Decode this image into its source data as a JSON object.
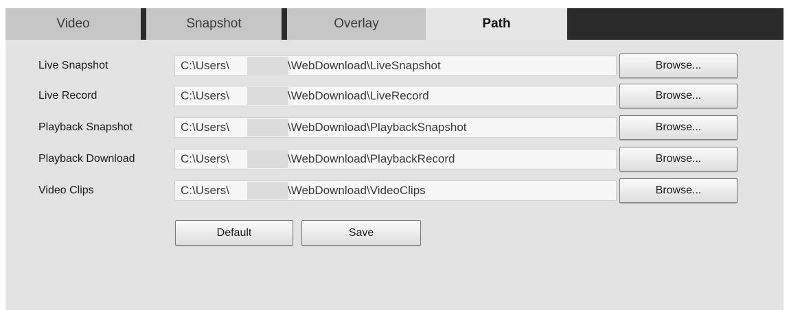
{
  "tabs": [
    {
      "label": "Video",
      "active": false
    },
    {
      "label": "Snapshot",
      "active": false
    },
    {
      "label": "Overlay",
      "active": false
    },
    {
      "label": "Path",
      "active": true
    }
  ],
  "paths": [
    {
      "label": "Live Snapshot",
      "prefix": "C:\\Users\\",
      "suffix": "\\WebDownload\\LiveSnapshot",
      "button": "Browse..."
    },
    {
      "label": "Live Record",
      "prefix": "C:\\Users\\",
      "suffix": "\\WebDownload\\LiveRecord",
      "button": "Browse..."
    },
    {
      "label": "Playback Snapshot",
      "prefix": "C:\\Users\\",
      "suffix": "\\WebDownload\\PlaybackSnapshot",
      "button": "Browse..."
    },
    {
      "label": "Playback Download",
      "prefix": "C:\\Users\\",
      "suffix": "\\WebDownload\\PlaybackRecord",
      "button": "Browse..."
    },
    {
      "label": "Video Clips",
      "prefix": "C:\\Users\\",
      "suffix": "\\WebDownload\\VideoClips",
      "button": "Browse..."
    }
  ],
  "actions": {
    "default_label": "Default",
    "save_label": "Save"
  },
  "colors": {
    "tab_bar": "#2a2a2a",
    "tab": "#c6c6c6",
    "tab_active": "#e6e6e6",
    "panel": "#e3e3e3"
  }
}
